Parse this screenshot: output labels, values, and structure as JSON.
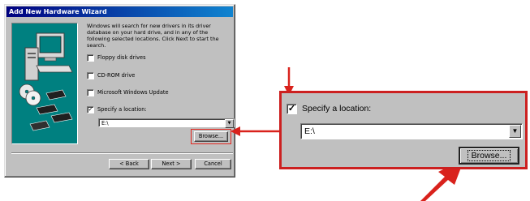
{
  "dialog": {
    "title": "Add New Hardware Wizard",
    "description": "Windows will search for new drivers in its driver database on your hard drive, and in any of the following selected locations. Click Next to start the search.",
    "options": [
      {
        "label": "Floppy disk drives",
        "checked": false,
        "mark": ""
      },
      {
        "label": "CD-ROM drive",
        "checked": false,
        "mark": ""
      },
      {
        "label": "Microsoft Windows Update",
        "checked": false,
        "mark": ""
      },
      {
        "label": "Specify a location:",
        "checked": true,
        "mark": "✓"
      }
    ],
    "location_value": "E:\\",
    "browse_label": "Browse...",
    "back_label": "< Back",
    "next_label": "Next >",
    "cancel_label": "Cancel",
    "dropdown_glyph": "▼"
  },
  "zoom": {
    "option_label": "Specify a location:",
    "option_mark": "✓",
    "location_value": "E:\\",
    "browse_label": "Browse...",
    "dropdown_glyph": "▼"
  },
  "colors": {
    "highlight": "#e3271f",
    "title_bar": "#000080",
    "panel": "#c0c0c0",
    "illustration_bg": "#008080"
  }
}
